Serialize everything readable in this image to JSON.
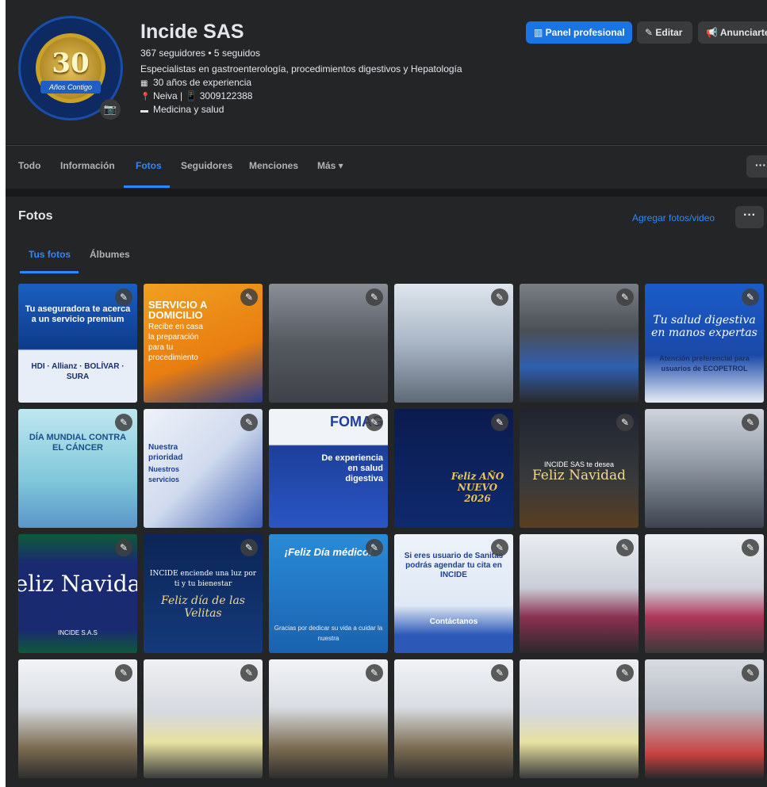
{
  "header": {
    "avatar_number": "30",
    "avatar_ribbon": "Años Contigo",
    "page_name": "Incide SAS",
    "followers": "367 seguidores • 5 seguidos",
    "bio": "Especialistas en gastroenterología, procedimientos digestivos y Hepatología",
    "experience": "30 años de experiencia",
    "location_phone": "Neiva | 📱 3009122388",
    "category": "Medicina y salud",
    "buttons": {
      "panel": "Panel profesional",
      "edit": "Editar",
      "ads": "Anunciarte"
    }
  },
  "tabs": {
    "items": [
      "Todo",
      "Información",
      "Fotos",
      "Seguidores",
      "Menciones",
      "Más ▾"
    ],
    "active": "Fotos",
    "more": "···"
  },
  "photos": {
    "title": "Fotos",
    "add": "Agregar fotos/video",
    "more": "···",
    "subtabs": [
      "Tus fotos",
      "Álbumes"
    ],
    "active_subtab": "Tus fotos"
  },
  "tiles": [
    {
      "cap": "Tu aseguradora te acerca a un servicio premium",
      "cap2": "HDI · Allianz · BOLÍVAR · SURA"
    },
    {
      "cap": "SERVICIO A DOMICILIO",
      "cap2": "Recibe en casa la preparación para tu procedimiento"
    },
    {
      "cap": "",
      "cap2": ""
    },
    {
      "cap": "",
      "cap2": ""
    },
    {
      "cap": "",
      "cap2": ""
    },
    {
      "cap": "Tu salud digestiva en manos expertas",
      "cap2": "Atención preferencial para usuarios de ECOPETROL"
    },
    {
      "cap": "DÍA MUNDIAL CONTRA EL CÁNCER",
      "cap2": ""
    },
    {
      "cap": "Nuestra prioridad",
      "cap2": "Nuestros servicios"
    },
    {
      "cap": "FOMAG",
      "cap2": "De experiencia en salud digestiva"
    },
    {
      "cap": "Feliz AÑO NUEVO 2026",
      "cap2": ""
    },
    {
      "cap": "INCIDE SAS te desea",
      "cap2": "Feliz Navidad"
    },
    {
      "cap": "",
      "cap2": ""
    },
    {
      "cap": "eliz Navida",
      "cap2": "INCIDE S.A.S"
    },
    {
      "cap": "INCIDE enciende una luz por ti y tu bienestar",
      "cap2": "Feliz día de las Velitas"
    },
    {
      "cap": "¡Feliz Día médico!",
      "cap2": "Gracias por dedicar su vida a cuidar la nuestra"
    },
    {
      "cap": "Si eres usuario de Sanitas podrás agendar tu cita en INCIDE",
      "cap2": "Contáctanos"
    },
    {
      "cap": "",
      "cap2": ""
    },
    {
      "cap": "",
      "cap2": ""
    },
    {
      "cap": "",
      "cap2": ""
    },
    {
      "cap": "",
      "cap2": ""
    },
    {
      "cap": "",
      "cap2": ""
    },
    {
      "cap": "",
      "cap2": ""
    },
    {
      "cap": "",
      "cap2": ""
    },
    {
      "cap": "",
      "cap2": ""
    }
  ],
  "edit_icon": "✎",
  "colors": {
    "accent": "#2d88ff",
    "primary_button": "#1b74e4",
    "surface": "#242526",
    "background": "#18191a"
  }
}
